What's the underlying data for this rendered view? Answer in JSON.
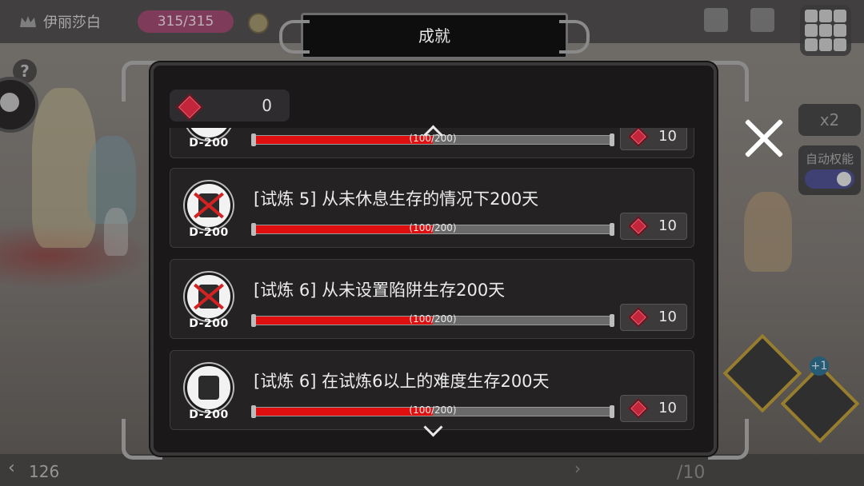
{
  "hud": {
    "player_name": "伊丽莎白",
    "hp": "315/315",
    "speed": "x2",
    "auto_label": "自动权能",
    "day": "126",
    "page": "/10",
    "help": "?"
  },
  "modal": {
    "title": "成就",
    "gem_count": "0"
  },
  "achievements": [
    {
      "tag": "D-200",
      "text": "",
      "progress_current": "100",
      "progress_total": "200",
      "progress_fraction": 0.5,
      "reward": "10"
    },
    {
      "tag": "D-200",
      "text": "[试炼 5] 从未休息生存的情况下200天",
      "progress_current": "100",
      "progress_total": "200",
      "progress_fraction": 0.5,
      "reward": "10"
    },
    {
      "tag": "D-200",
      "text": "[试炼 6] 从未设置陷阱生存200天",
      "progress_current": "100",
      "progress_total": "200",
      "progress_fraction": 0.5,
      "reward": "10"
    },
    {
      "tag": "D-200",
      "text": "[试炼 6] 在试炼6以上的难度生存200天",
      "progress_current": "100",
      "progress_total": "200",
      "progress_fraction": 0.5,
      "reward": "10"
    }
  ],
  "colors": {
    "progress_fill": "#e00f0f",
    "gem": "#c3253a",
    "modal_bg": "#1a1819"
  }
}
